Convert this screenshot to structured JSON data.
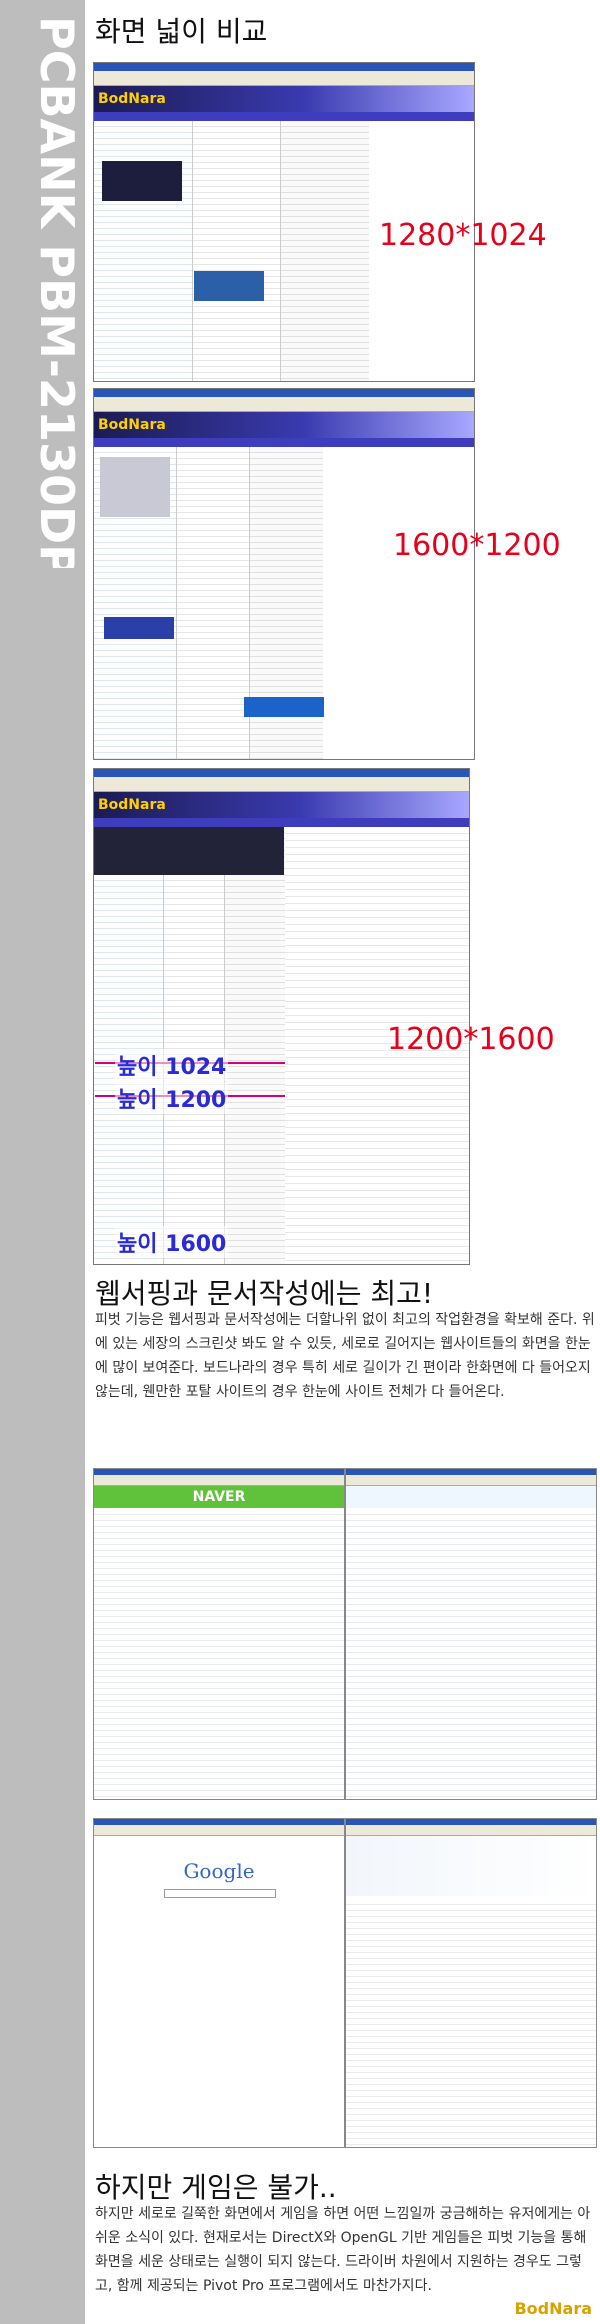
{
  "side_title": "PCBANK PBM-2130DP",
  "sections": {
    "area_compare": "화면 넓이 비교",
    "web_title": "웹서핑과 문서작성에는 최고!",
    "game_title": "하지만 게임은 불가.."
  },
  "resolutions": [
    "1280*1024",
    "1600*1200",
    "1200*1600"
  ],
  "height_labels": [
    "높이 1024",
    "높이 1200",
    "높이 1600"
  ],
  "site_logo": "BodNara",
  "naver_logo": "NAVER",
  "google_logo": "Google",
  "paragraphs": {
    "web": "피벗 기능은 웹서핑과 문서작성에는 더할나위 없이 최고의 작업환경을 확보해 준다. 위에 있는 세장의 스크린샷 봐도 알 수 있듯, 세로로 길어지는 웹사이트들의 화면을 한눈에 많이 보여준다. 보드나라의 경우 특히 세로 길이가 긴 편이라 한화면에 다 들어오지 않는데, 웬만한 포탈 사이트의 경우 한눈에 사이트 전체가 다 들어온다.",
    "game": "하지만 세로로 길쭉한 화면에서 게임을 하면 어떤 느낌일까 궁금해하는 유저에게는 아쉬운 소식이 있다. 현재로서는 DirectX와 OpenGL 기반 게임들은 피벗 기능을 통해 화면을 세운 상태로는 실행이 되지 않는다. 드라이버 차원에서 지원하는 경우도 그렇고, 함께 제공되는 Pivot Pro 프로그램에서도 마찬가지다."
  },
  "colors": {
    "accent_red": "#e8001a",
    "accent_blue": "#2b2bd6",
    "sidebar": "#bdbdbd"
  }
}
